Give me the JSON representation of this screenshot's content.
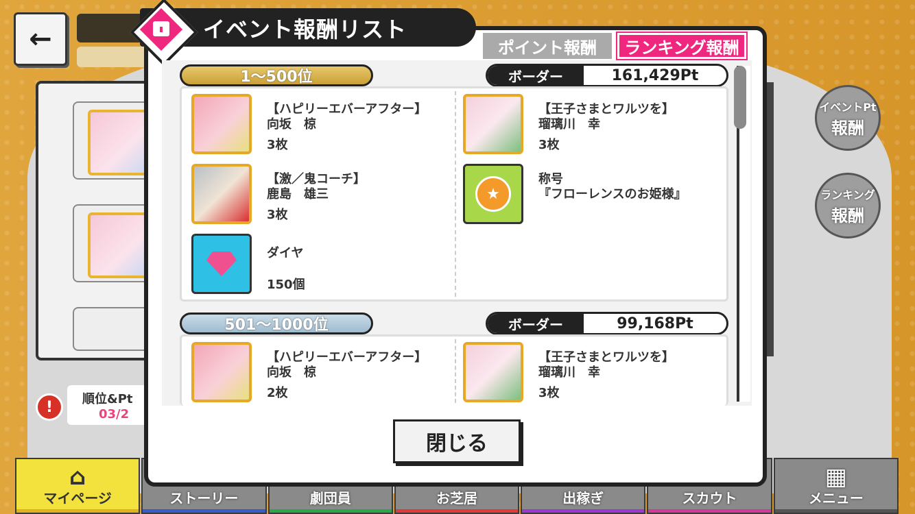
{
  "background": {
    "rank_info_title": "順位&Pt",
    "rank_info_date": "03/2",
    "side_buttons": [
      {
        "line1": "イベントPt",
        "line2": "報酬"
      },
      {
        "line1": "ランキング",
        "line2": "報酬"
      }
    ]
  },
  "bottom_nav": [
    {
      "label": "マイページ",
      "icon": "home-icon",
      "bar_color": "#e2b020",
      "active": true
    },
    {
      "label": "ストーリー",
      "icon": "",
      "bar_color": "#3a5cc8",
      "active": false
    },
    {
      "label": "劇団員",
      "icon": "",
      "bar_color": "#2aa84a",
      "active": false
    },
    {
      "label": "お芝居",
      "icon": "",
      "bar_color": "#e03a3a",
      "active": false
    },
    {
      "label": "出稼ぎ",
      "icon": "",
      "bar_color": "#9a3ad0",
      "active": false
    },
    {
      "label": "スカウト",
      "icon": "",
      "bar_color": "#d03a9a",
      "active": false
    },
    {
      "label": "メニュー",
      "icon": "grid-icon",
      "bar_color": "#555555",
      "active": false
    }
  ],
  "modal": {
    "title": "イベント報酬リスト",
    "tabs": {
      "point": "ポイント報酬",
      "ranking": "ランキング報酬"
    },
    "close_label": "閉じる",
    "border_label": "ボーダー",
    "tiers": [
      {
        "range": "1〜500位",
        "border_value": "161,429Pt",
        "rewards": [
          {
            "line1": "【ハピリーエバーアフター】",
            "line2": "向坂　椋",
            "count": "3枚",
            "icon": "character-card-icon"
          },
          {
            "line1": "【王子さまとワルツを】",
            "line2": "瑠璃川　幸",
            "count": "3枚",
            "icon": "character-card-icon"
          },
          {
            "line1": "【激／鬼コーチ】",
            "line2": "鹿島　雄三",
            "count": "3枚",
            "icon": "character-card-icon"
          },
          {
            "line1": "称号",
            "line2": "『フローレンスのお姫様』",
            "count": "",
            "icon": "title-badge-icon"
          },
          {
            "line1": "ダイヤ",
            "line2": "",
            "count": "150個",
            "icon": "diamond-icon"
          }
        ]
      },
      {
        "range": "501〜1000位",
        "border_value": "99,168Pt",
        "rewards": [
          {
            "line1": "【ハピリーエバーアフター】",
            "line2": "向坂　椋",
            "count": "2枚",
            "icon": "character-card-icon"
          },
          {
            "line1": "【王子さまとワルツを】",
            "line2": "瑠璃川　幸",
            "count": "3枚",
            "icon": "character-card-icon"
          }
        ]
      }
    ]
  }
}
